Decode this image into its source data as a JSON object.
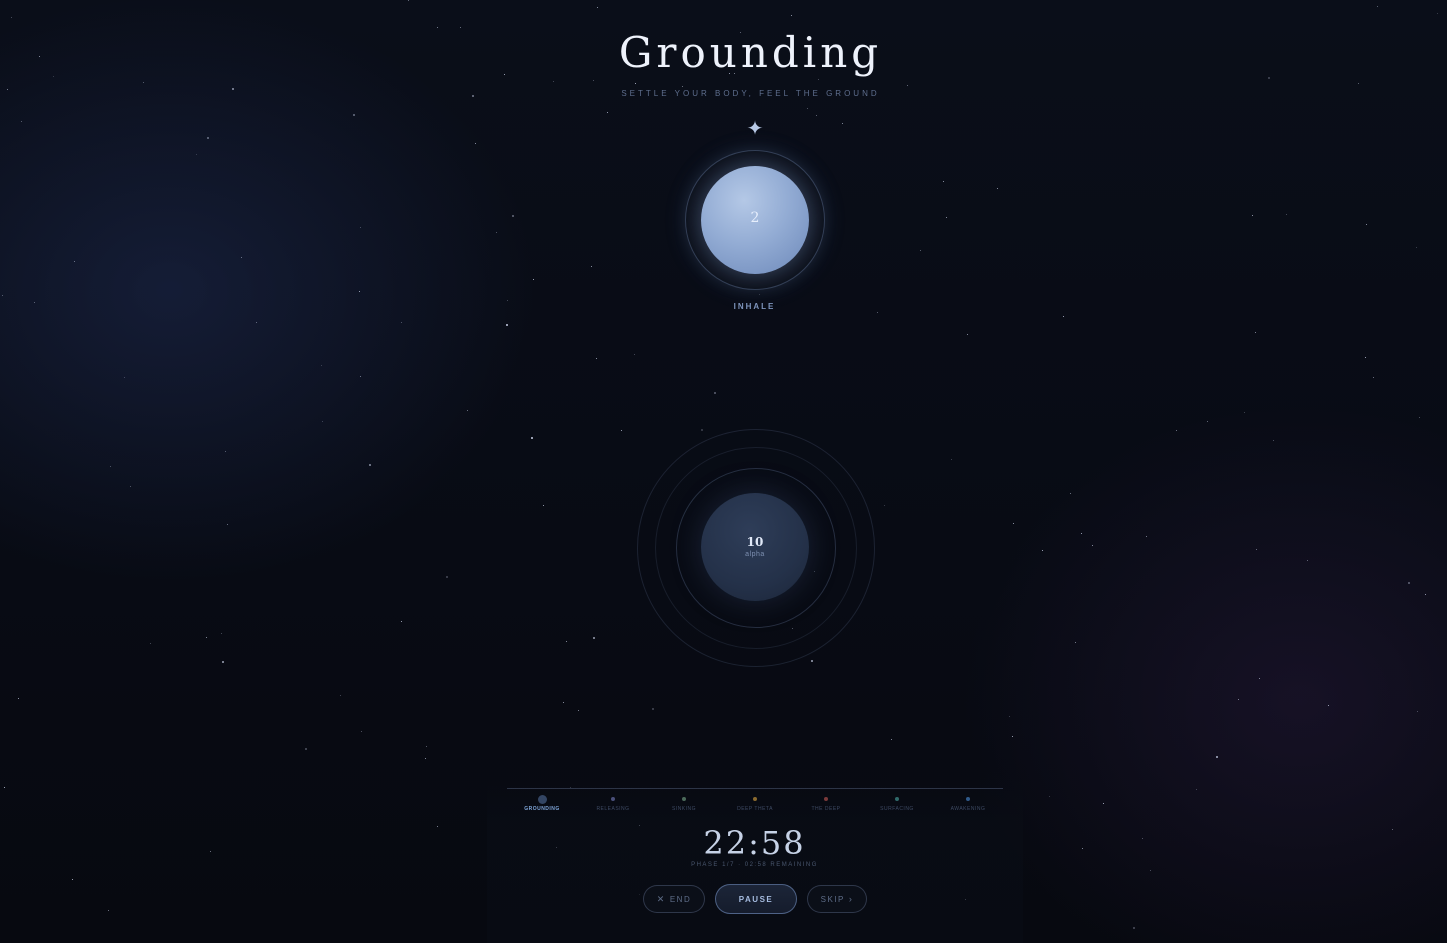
{
  "header": {
    "title": "Grounding",
    "subtitle": "SETTLE YOUR BODY, FEEL THE GROUND",
    "sparkle_icon": "four-point-star-icon"
  },
  "breath": {
    "count": "2",
    "label": "INHALE"
  },
  "brainwave": {
    "frequency": "10",
    "band": "alpha"
  },
  "phases": [
    {
      "label": "GROUNDING",
      "color": "#334563",
      "active": true
    },
    {
      "label": "RELEASING",
      "color": "#4a4f7a",
      "active": false
    },
    {
      "label": "SINKING",
      "color": "#4b6a5a",
      "active": false
    },
    {
      "label": "DEEP THETA",
      "color": "#8a6a2e",
      "active": false
    },
    {
      "label": "THE DEEP",
      "color": "#7a3a3a",
      "active": false
    },
    {
      "label": "SURFACING",
      "color": "#2f6a6a",
      "active": false
    },
    {
      "label": "AWAKENING",
      "color": "#2f5a8a",
      "active": false
    }
  ],
  "timer": {
    "display": "22:58",
    "phase_info": "PHASE 1/7 · 02:58 REMAINING"
  },
  "controls": {
    "end_label": "END",
    "end_icon": "close-icon",
    "pause_label": "PAUSE",
    "skip_label": "SKIP",
    "skip_icon": "arrow-right-icon"
  },
  "colors": {
    "background": "#080b14",
    "accent": "#93acd4",
    "active_phase_label": "#7ea5d8"
  }
}
